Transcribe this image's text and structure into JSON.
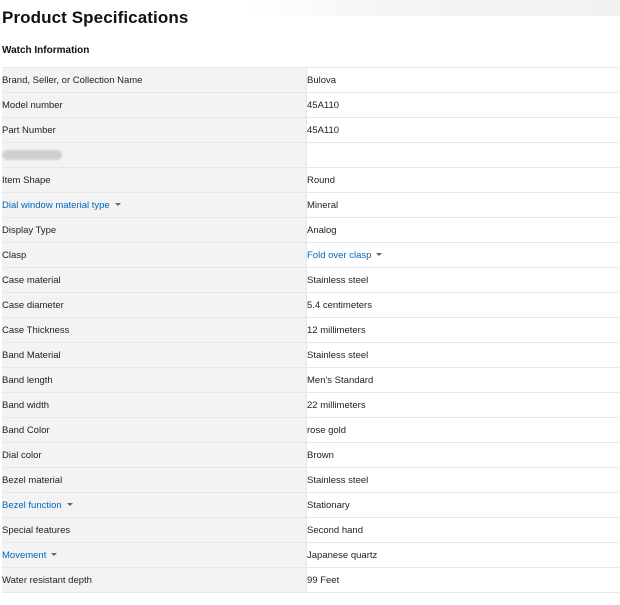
{
  "page": {
    "title": "Product Specifications",
    "section_title": "Watch Information"
  },
  "colors": {
    "link": "#0066c0",
    "label_bg": "#f3f3f3",
    "border": "#e7e7e7"
  },
  "specs": [
    {
      "label": "Brand, Seller, or Collection Name",
      "value": "Bulova"
    },
    {
      "label": "Model number",
      "value": "45A110"
    },
    {
      "label": "Part Number",
      "value": "45A110"
    },
    {
      "label": "",
      "value": "",
      "label_redacted": true
    },
    {
      "label": "Item Shape",
      "value": "Round"
    },
    {
      "label": "Dial window material type",
      "value": "Mineral",
      "label_link": true
    },
    {
      "label": "Display Type",
      "value": "Analog"
    },
    {
      "label": "Clasp",
      "value": "Fold over clasp",
      "value_link": true
    },
    {
      "label": "Case material",
      "value": "Stainless steel"
    },
    {
      "label": "Case diameter",
      "value": "5.4 centimeters"
    },
    {
      "label": "Case Thickness",
      "value": "12 millimeters"
    },
    {
      "label": "Band Material",
      "value": "Stainless steel"
    },
    {
      "label": "Band length",
      "value": "Men's Standard"
    },
    {
      "label": "Band width",
      "value": "22 millimeters"
    },
    {
      "label": "Band Color",
      "value": "rose gold"
    },
    {
      "label": "Dial color",
      "value": "Brown"
    },
    {
      "label": "Bezel material",
      "value": "Stainless steel"
    },
    {
      "label": "Bezel function",
      "value": "Stationary",
      "label_link": true
    },
    {
      "label": "Special features",
      "value": "Second hand"
    },
    {
      "label": "Movement",
      "value": "Japanese quartz",
      "label_link": true
    },
    {
      "label": "Water resistant depth",
      "value": "99 Feet"
    }
  ]
}
